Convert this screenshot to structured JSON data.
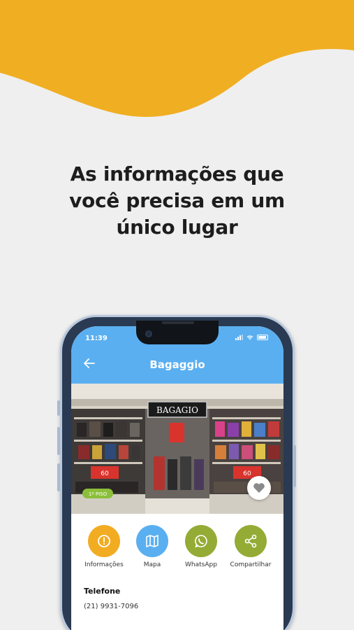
{
  "colors": {
    "banner": "#f0ae22",
    "background": "#efefef",
    "header": "#5aaff0",
    "info_icon": "#f2ac22",
    "map_icon": "#5aaff0",
    "whatsapp_icon": "#94ab36",
    "share_icon": "#94ab36"
  },
  "headline": {
    "line1": "As informações que",
    "line2": "você precisa em um",
    "line3": "único lugar"
  },
  "status_bar": {
    "time": "11:39"
  },
  "app_header": {
    "title": "Bagaggio",
    "back_icon": "arrow-left-icon"
  },
  "store_photo": {
    "sign": "BAGAGIO",
    "floor_badge": "1º PISO"
  },
  "favorite": {
    "icon": "heart-icon"
  },
  "actions": [
    {
      "label": "Informações",
      "icon": "alert-circle-icon"
    },
    {
      "label": "Mapa",
      "icon": "map-icon"
    },
    {
      "label": "WhatsApp",
      "icon": "whatsapp-icon"
    },
    {
      "label": "Compartilhar",
      "icon": "share-icon"
    }
  ],
  "contact": {
    "label": "Telefone",
    "value": "(21) 9931-7096"
  }
}
